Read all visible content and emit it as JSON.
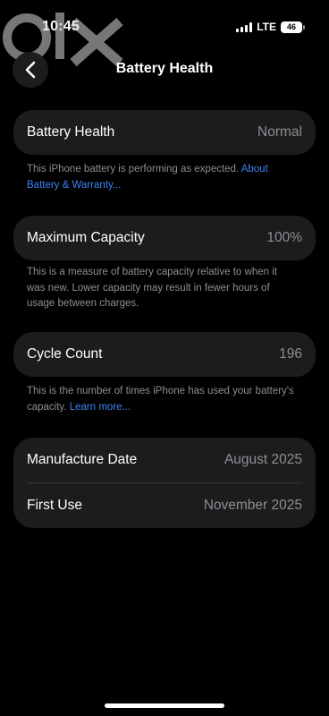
{
  "status_bar": {
    "time": "10:45",
    "network": "LTE",
    "battery_level": "46"
  },
  "nav": {
    "title": "Battery Health"
  },
  "battery_health": {
    "label": "Battery Health",
    "value": "Normal",
    "note": "This iPhone battery is performing as expected. ",
    "note_link": "About Battery & Warranty..."
  },
  "maximum_capacity": {
    "label": "Maximum Capacity",
    "value": "100%",
    "note": "This is a measure of battery capacity relative to when it was new. Lower capacity may result in fewer hours of usage between charges."
  },
  "cycle_count": {
    "label": "Cycle Count",
    "value": "196",
    "note": "This is the number of times iPhone has used your battery's capacity. ",
    "note_link": "Learn more..."
  },
  "dates": {
    "manufacture_label": "Manufacture Date",
    "manufacture_value": "August 2025",
    "first_use_label": "First Use",
    "first_use_value": "November 2025"
  },
  "colors": {
    "background": "#000000",
    "card": "#1c1c1e",
    "secondary_text": "#8e8e93",
    "link": "#3b82f6"
  }
}
